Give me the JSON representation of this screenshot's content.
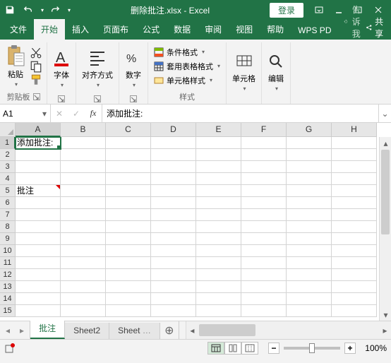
{
  "titlebar": {
    "filename": "删除批注.xlsx - Excel",
    "login": "登录"
  },
  "tabs": {
    "file": "文件",
    "home": "开始",
    "insert": "插入",
    "layout": "页面布",
    "formulas": "公式",
    "data": "数据",
    "review": "审阅",
    "view": "视图",
    "help": "帮助",
    "wps": "WPS PD",
    "tellme": "告诉我",
    "share": "共享"
  },
  "ribbon": {
    "paste": "粘贴",
    "clipboard": "剪贴板",
    "font": "字体",
    "alignment": "对齐方式",
    "number": "数字",
    "cond_format": "条件格式",
    "table_format": "套用表格格式",
    "cell_styles": "单元格样式",
    "styles": "样式",
    "cells": "单元格",
    "editing": "编辑"
  },
  "formula_bar": {
    "name_box": "A1",
    "formula": "添加批注:"
  },
  "columns": [
    "A",
    "B",
    "C",
    "D",
    "E",
    "F",
    "G",
    "H"
  ],
  "grid": {
    "active_cell": "A1",
    "cells": {
      "A1": "添加批注:",
      "A5": "批注"
    },
    "comment_cells": [
      "A5"
    ],
    "visible_rows": 15
  },
  "sheets": {
    "tabs": [
      "批注",
      "Sheet2",
      "Sheet"
    ],
    "active": 0
  },
  "status": {
    "zoom": "100%"
  }
}
